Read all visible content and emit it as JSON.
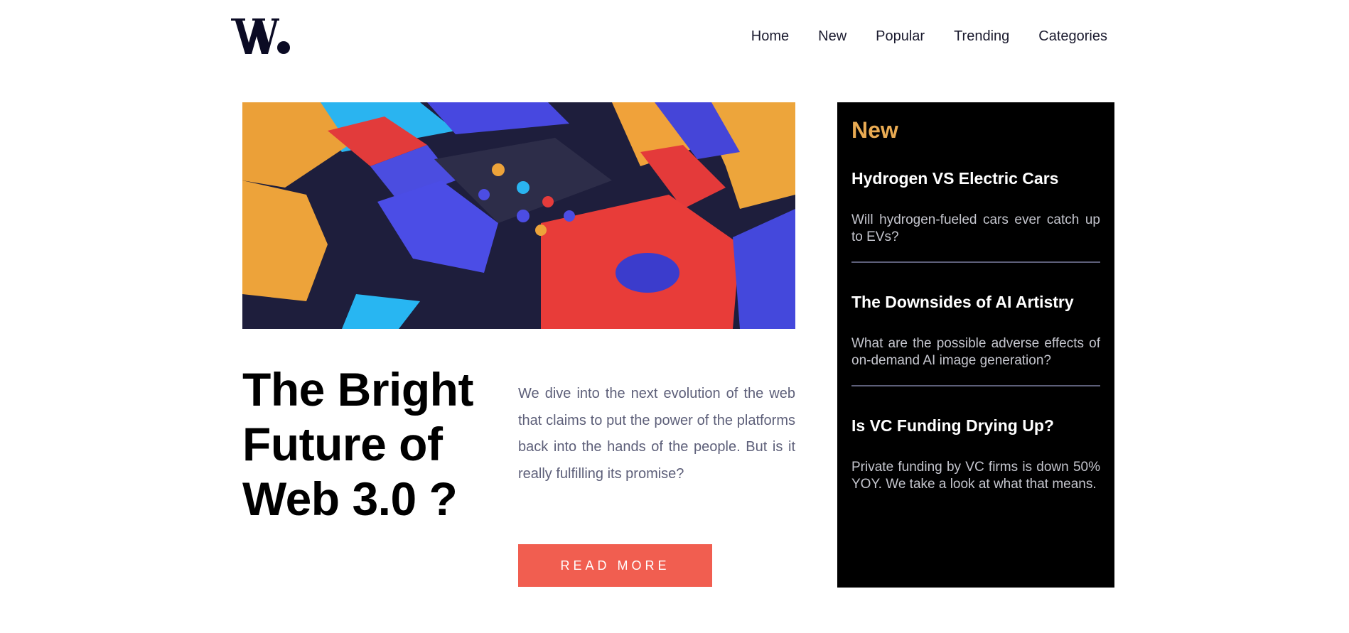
{
  "logo": {
    "text": "W.",
    "icon": "w-logo-icon"
  },
  "nav": {
    "items": [
      {
        "label": "Home"
      },
      {
        "label": "New"
      },
      {
        "label": "Popular"
      },
      {
        "label": "Trending"
      },
      {
        "label": "Categories"
      }
    ]
  },
  "hero": {
    "image_icon": "colorful-3d-blocks-illustration",
    "title": "The Bright Future of Web 3.0 ?",
    "description": "We dive into the next evolution of the web that claims to put the power of the platforms back into the hands of the people. But is it really fulfilling its promise?",
    "cta_label": "READ MORE"
  },
  "sidebar": {
    "title": "New",
    "items": [
      {
        "title": "Hydrogen VS Electric Cars",
        "text": "Will hydrogen-fueled cars ever catch up to EVs?"
      },
      {
        "title": "The Downsides of AI Artistry",
        "text": "What are the possible adverse effects of on-demand AI image generation?"
      },
      {
        "title": "Is VC Funding Drying Up?",
        "text": "Private funding by VC firms is down 50% YOY. We take a look at what that means."
      }
    ]
  },
  "colors": {
    "accent_red": "#f15e50",
    "accent_orange": "#e9ab53",
    "sidebar_bg": "#000000",
    "text_dark": "#00001a",
    "text_muted": "#5d5f79"
  }
}
